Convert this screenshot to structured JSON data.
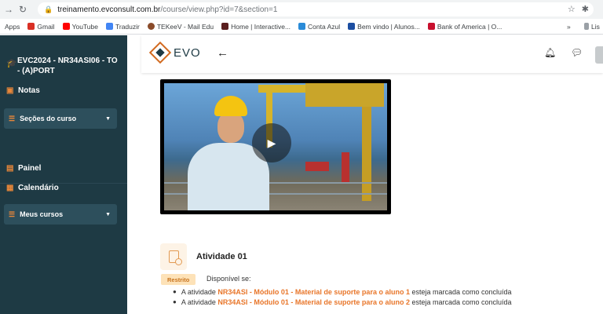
{
  "browser": {
    "url_host": "treinamento.evconsult.com.br",
    "url_path": "/course/view.php?id=7&section=1",
    "bookmarks": [
      {
        "label": "Apps",
        "color": "#5f6368"
      },
      {
        "label": "Gmail",
        "color": "#d93025"
      },
      {
        "label": "YouTube",
        "color": "#ff0000"
      },
      {
        "label": "Traduzir",
        "color": "#4285f4"
      },
      {
        "label": "TEKeeV - Mail Edu",
        "color": "#8a4b2a"
      },
      {
        "label": "Home | Interactive...",
        "color": "#5a1e1e"
      },
      {
        "label": "Conta Azul",
        "color": "#2a8bd8"
      },
      {
        "label": "Bem vindo | Alunos...",
        "color": "#1c4ea1"
      },
      {
        "label": "Bank of America | O...",
        "color": "#c8102e"
      }
    ],
    "bookmarks_overflow": "»",
    "reading_list": "Lis"
  },
  "sidebar": {
    "course_title": "EVC2024 - NR34ASI06 - TO - (A)PORT",
    "notas_label": "Notas",
    "secoes_label": "Seções do curso",
    "painel_label": "Painel",
    "calendario_label": "Calendário",
    "meus_cursos_label": "Meus cursos"
  },
  "topbar": {
    "logo_text": "EVO",
    "icons": [
      "back-arrow-icon",
      "bell-icon",
      "chat-icon",
      "avatar"
    ]
  },
  "video": {
    "play_symbol": "▶"
  },
  "activity": {
    "title": "Atividade 01",
    "badge": "Restrito",
    "available_text": "Disponível se:",
    "restrictions": [
      {
        "prefix": "A atividade",
        "link": "NR34ASI - Módulo 01 - Material de suporte para o aluno 1",
        "suffix": "esteja marcada como concluída"
      },
      {
        "prefix": "A atividade",
        "link": "NR34ASI - Módulo 01 - Material de suporte para o aluno 2",
        "suffix": "esteja marcada como concluída"
      }
    ]
  },
  "colors": {
    "sidebar_bg": "#1e3a44",
    "accent_orange": "#e8762a",
    "badge_bg": "#fde2b8"
  }
}
